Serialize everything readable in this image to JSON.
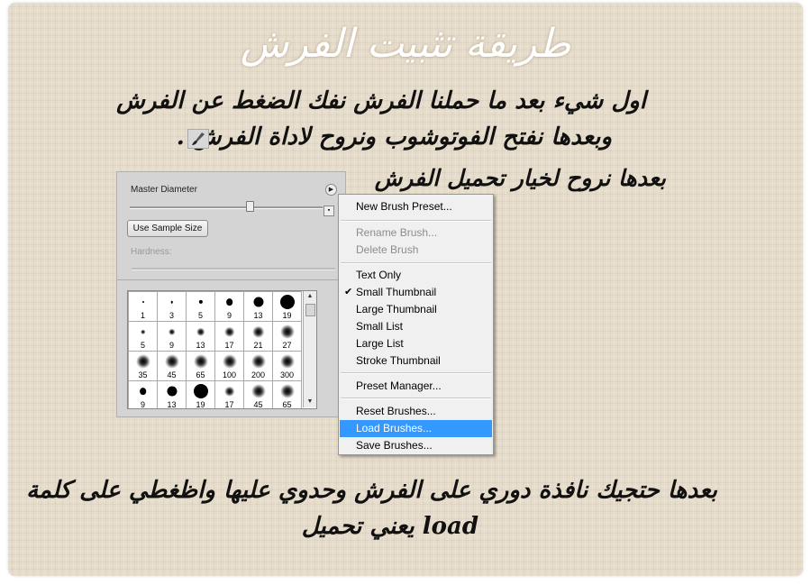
{
  "title": "طريقة تثبيت الفرش",
  "instructions": {
    "line1": "اول شيء بعد ما حملنا الفرش نفك الضغط عن الفرش",
    "line2": "وبعدها نفتح الفوتوشوب ونروح لاداة الفرش .",
    "line3": "بعدها نروح لخيار تحميل الفرش",
    "line4": "بعدها حتجيك نافذة دوري على الفرش وحدوي عليها واظغطي على كلمة",
    "line5": "load يعني تحميل"
  },
  "brush_tool_icon": "brush-icon",
  "panel": {
    "master_diameter_label": "Master Diameter",
    "sample_size_button": "Use Sample Size",
    "hardness_label": "Hardness:",
    "master_diameter_level": 0.62,
    "brushes": [
      {
        "size": "1",
        "kind": "hard"
      },
      {
        "size": "3",
        "kind": "hard"
      },
      {
        "size": "5",
        "kind": "hard"
      },
      {
        "size": "9",
        "kind": "hard"
      },
      {
        "size": "13",
        "kind": "hard"
      },
      {
        "size": "19",
        "kind": "hard"
      },
      {
        "size": "5",
        "kind": "soft"
      },
      {
        "size": "9",
        "kind": "soft"
      },
      {
        "size": "13",
        "kind": "soft"
      },
      {
        "size": "17",
        "kind": "soft"
      },
      {
        "size": "21",
        "kind": "soft"
      },
      {
        "size": "27",
        "kind": "soft"
      },
      {
        "size": "35",
        "kind": "soft"
      },
      {
        "size": "45",
        "kind": "soft"
      },
      {
        "size": "65",
        "kind": "soft"
      },
      {
        "size": "100",
        "kind": "soft"
      },
      {
        "size": "200",
        "kind": "soft"
      },
      {
        "size": "300",
        "kind": "soft"
      },
      {
        "size": "9",
        "kind": "hard"
      },
      {
        "size": "13",
        "kind": "hard"
      },
      {
        "size": "19",
        "kind": "hard"
      },
      {
        "size": "17",
        "kind": "soft"
      },
      {
        "size": "45",
        "kind": "soft"
      },
      {
        "size": "65",
        "kind": "soft"
      }
    ]
  },
  "menu": {
    "items": [
      {
        "label": "New Brush Preset...",
        "state": "normal"
      },
      {
        "label": "Rename Brush...",
        "state": "disabled"
      },
      {
        "label": "Delete Brush",
        "state": "disabled"
      },
      {
        "label": "Text Only",
        "state": "normal"
      },
      {
        "label": "Small Thumbnail",
        "state": "checked"
      },
      {
        "label": "Large Thumbnail",
        "state": "normal"
      },
      {
        "label": "Small List",
        "state": "normal"
      },
      {
        "label": "Large List",
        "state": "normal"
      },
      {
        "label": "Stroke Thumbnail",
        "state": "normal"
      },
      {
        "label": "Preset Manager...",
        "state": "normal"
      },
      {
        "label": "Reset Brushes...",
        "state": "normal"
      },
      {
        "label": "Load Brushes...",
        "state": "highlighted"
      },
      {
        "label": "Save Brushes...",
        "state": "normal"
      }
    ],
    "check_glyph": "✔",
    "highlight_color": "#3399ff"
  }
}
